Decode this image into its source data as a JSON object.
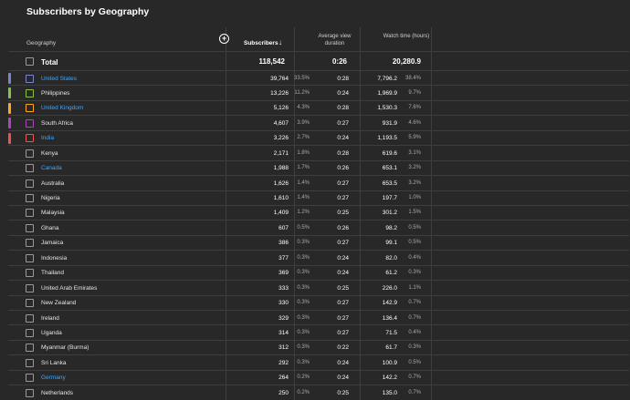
{
  "title": "Subscribers by Geography",
  "headers": {
    "geography": "Geography",
    "subscribers": "Subscribers",
    "avg_view_duration": "Average view duration",
    "watch_time": "Watch time (hours)"
  },
  "total": {
    "label": "Total",
    "subscribers": "118,542",
    "avd": "0:26",
    "watch_time": "20,280.9"
  },
  "rows": [
    {
      "name": "United States",
      "link": true,
      "marker": "#7986cb",
      "subs": "39,764",
      "subs_pct": "33.5%",
      "avd": "0:28",
      "wt": "7,796.2",
      "wt_pct": "38.4%"
    },
    {
      "name": "Philippines",
      "link": false,
      "marker": "#8bc34a",
      "subs": "13,226",
      "subs_pct": "11.2%",
      "avd": "0:24",
      "wt": "1,969.9",
      "wt_pct": "9.7%"
    },
    {
      "name": "United Kingdom",
      "link": true,
      "marker": "#ffa726",
      "subs": "5,126",
      "subs_pct": "4.3%",
      "avd": "0:28",
      "wt": "1,530.3",
      "wt_pct": "7.6%"
    },
    {
      "name": "South Africa",
      "link": false,
      "marker": "#ab47bc",
      "subs": "4,607",
      "subs_pct": "3.9%",
      "avd": "0:27",
      "wt": "931.9",
      "wt_pct": "4.6%"
    },
    {
      "name": "India",
      "link": true,
      "marker": "#ef5350",
      "subs": "3,226",
      "subs_pct": "2.7%",
      "avd": "0:24",
      "wt": "1,193.5",
      "wt_pct": "5.9%"
    },
    {
      "name": "Kenya",
      "link": false,
      "marker": "",
      "subs": "2,171",
      "subs_pct": "1.8%",
      "avd": "0:28",
      "wt": "619.6",
      "wt_pct": "3.1%"
    },
    {
      "name": "Canada",
      "link": true,
      "marker": "",
      "subs": "1,988",
      "subs_pct": "1.7%",
      "avd": "0:26",
      "wt": "653.1",
      "wt_pct": "3.2%"
    },
    {
      "name": "Australia",
      "link": false,
      "marker": "",
      "subs": "1,626",
      "subs_pct": "1.4%",
      "avd": "0:27",
      "wt": "653.5",
      "wt_pct": "3.2%"
    },
    {
      "name": "Nigeria",
      "link": false,
      "marker": "",
      "subs": "1,610",
      "subs_pct": "1.4%",
      "avd": "0:27",
      "wt": "197.7",
      "wt_pct": "1.0%"
    },
    {
      "name": "Malaysia",
      "link": false,
      "marker": "",
      "subs": "1,409",
      "subs_pct": "1.2%",
      "avd": "0:25",
      "wt": "301.2",
      "wt_pct": "1.5%"
    },
    {
      "name": "Ghana",
      "link": false,
      "marker": "",
      "subs": "607",
      "subs_pct": "0.5%",
      "avd": "0:26",
      "wt": "98.2",
      "wt_pct": "0.5%"
    },
    {
      "name": "Jamaica",
      "link": false,
      "marker": "",
      "subs": "386",
      "subs_pct": "0.3%",
      "avd": "0:27",
      "wt": "99.1",
      "wt_pct": "0.5%"
    },
    {
      "name": "Indonesia",
      "link": false,
      "marker": "",
      "subs": "377",
      "subs_pct": "0.3%",
      "avd": "0:24",
      "wt": "82.0",
      "wt_pct": "0.4%"
    },
    {
      "name": "Thailand",
      "link": false,
      "marker": "",
      "subs": "369",
      "subs_pct": "0.3%",
      "avd": "0:24",
      "wt": "61.2",
      "wt_pct": "0.3%"
    },
    {
      "name": "United Arab Emirates",
      "link": false,
      "marker": "",
      "subs": "333",
      "subs_pct": "0.3%",
      "avd": "0:25",
      "wt": "226.0",
      "wt_pct": "1.1%"
    },
    {
      "name": "New Zealand",
      "link": false,
      "marker": "",
      "subs": "330",
      "subs_pct": "0.3%",
      "avd": "0:27",
      "wt": "142.9",
      "wt_pct": "0.7%"
    },
    {
      "name": "Ireland",
      "link": false,
      "marker": "",
      "subs": "329",
      "subs_pct": "0.3%",
      "avd": "0:27",
      "wt": "136.4",
      "wt_pct": "0.7%"
    },
    {
      "name": "Uganda",
      "link": false,
      "marker": "",
      "subs": "314",
      "subs_pct": "0.3%",
      "avd": "0:27",
      "wt": "71.5",
      "wt_pct": "0.4%"
    },
    {
      "name": "Myanmar (Burma)",
      "link": false,
      "marker": "",
      "subs": "312",
      "subs_pct": "0.3%",
      "avd": "0:22",
      "wt": "61.7",
      "wt_pct": "0.3%"
    },
    {
      "name": "Sri Lanka",
      "link": false,
      "marker": "",
      "subs": "292",
      "subs_pct": "0.3%",
      "avd": "0:24",
      "wt": "100.9",
      "wt_pct": "0.5%"
    },
    {
      "name": "Germany",
      "link": true,
      "marker": "",
      "subs": "264",
      "subs_pct": "0.2%",
      "avd": "0:24",
      "wt": "142.2",
      "wt_pct": "0.7%"
    },
    {
      "name": "Netherlands",
      "link": false,
      "marker": "",
      "subs": "250",
      "subs_pct": "0.2%",
      "avd": "0:25",
      "wt": "135.0",
      "wt_pct": "0.7%"
    }
  ]
}
